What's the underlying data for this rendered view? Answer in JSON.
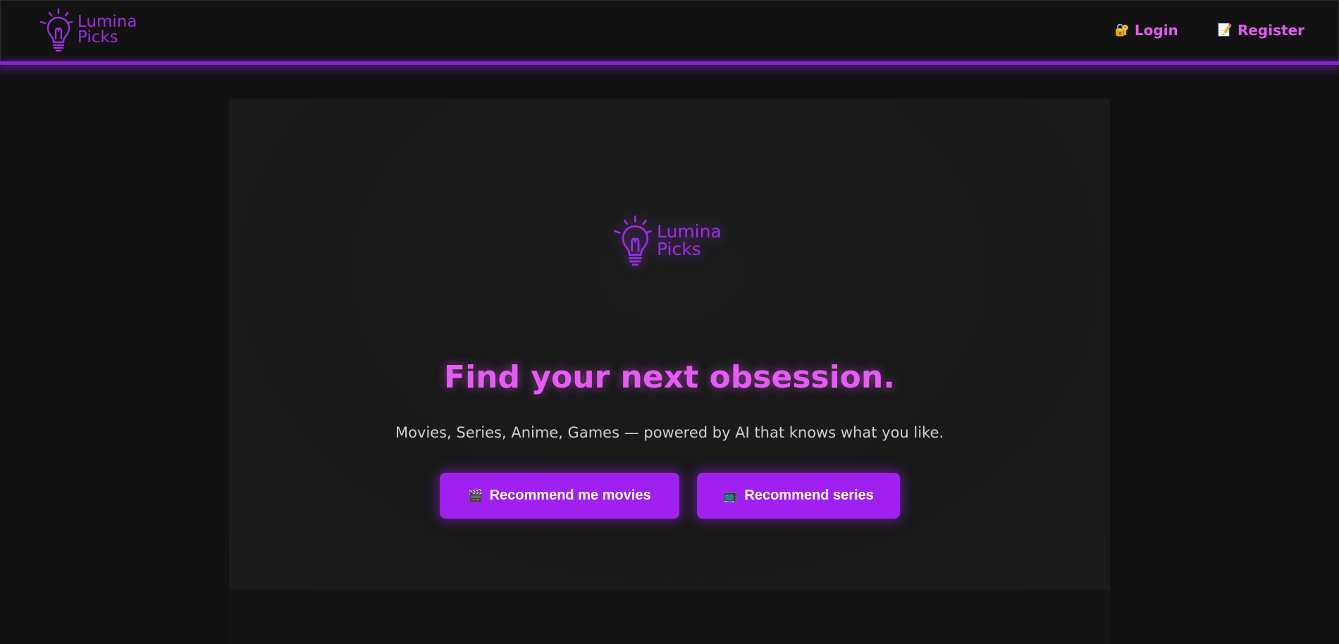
{
  "brand": {
    "line1": "Lumina",
    "line2": "Picks"
  },
  "nav": {
    "login": {
      "icon": "🔐",
      "label": "Login"
    },
    "register": {
      "icon": "📝",
      "label": "Register"
    }
  },
  "hero": {
    "logo_line1": "Lumina",
    "logo_line2": "Picks",
    "title": "Find your next obsession.",
    "subtitle": "Movies, Series, Anime, Games — powered by AI that knows what you like.",
    "buttons": {
      "movies": {
        "icon": "🎬",
        "label": "Recommend me movies"
      },
      "series": {
        "icon": "📺",
        "label": "Recommend series"
      }
    }
  },
  "colors": {
    "accent": "#a020f0",
    "brand_purple": "#9b2ee0",
    "link_pink": "#e05cf0",
    "background": "#111111"
  },
  "icons": {
    "brand": "lightbulb-icon"
  }
}
